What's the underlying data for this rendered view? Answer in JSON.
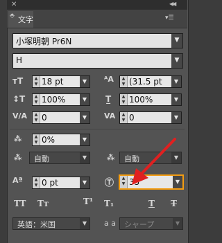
{
  "panel": {
    "tab_label": "文字",
    "font_family": "小塚明朝 Pr6N",
    "font_style": "H"
  },
  "rows": {
    "font_size": "18 pt",
    "leading": "(31.5 pt",
    "vertical_scale": "100%",
    "horizontal_scale": "100%",
    "kerning": "0",
    "tracking": "0",
    "tsume": "0%",
    "aki_left": "自動",
    "aki_right": "自動",
    "baseline_shift": "0 pt",
    "char_rotation": "35"
  },
  "bottom": {
    "language": "英語：米国",
    "antialias_label": "a a",
    "antialias": "シャープ"
  },
  "colors": {
    "highlight": "#f39c12",
    "arrow": "#e02020"
  }
}
